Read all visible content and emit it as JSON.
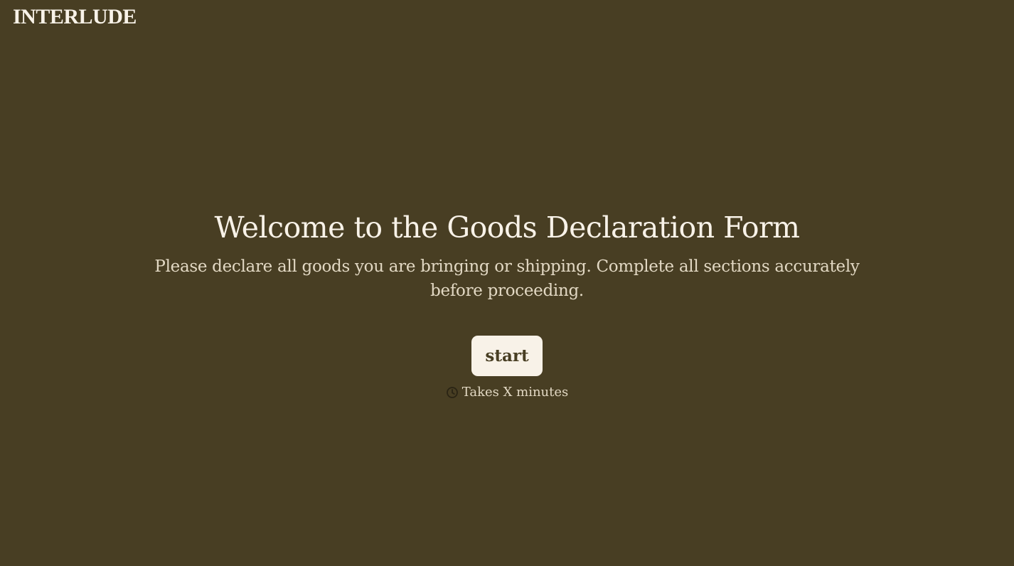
{
  "header": {
    "logo_text": "INTERLUDE"
  },
  "welcome": {
    "title": "Welcome to the Goods Declaration Form",
    "description": "Please declare all goods you are bringing or shipping. Complete all sections accurately before proceeding.",
    "start_label": "start",
    "duration_text": "Takes X minutes",
    "duration_icon": "clock-icon"
  },
  "colors": {
    "background": "#483e23",
    "text_primary": "#f8f2e8",
    "text_secondary": "#e2d8c3",
    "button_bg": "#f8f2e8",
    "button_text": "#483e23"
  }
}
